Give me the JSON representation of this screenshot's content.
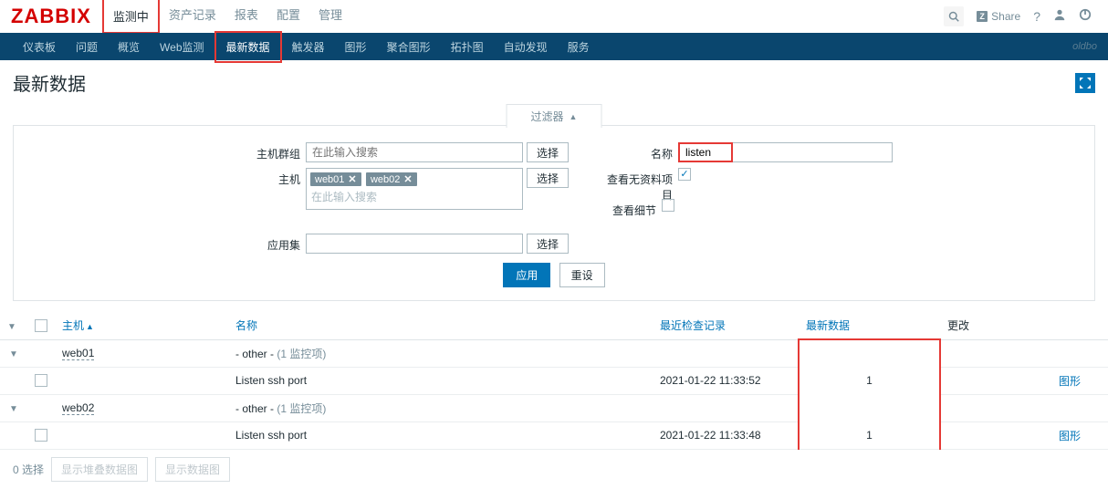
{
  "logo": "ZABBIX",
  "topMenu": [
    "监测中",
    "资产记录",
    "报表",
    "配置",
    "管理"
  ],
  "share": "Share",
  "subMenu": [
    "仪表板",
    "问题",
    "概览",
    "Web监测",
    "最新数据",
    "触发器",
    "图形",
    "聚合图形",
    "拓扑图",
    "自动发现",
    "服务"
  ],
  "subRight": "oldbo",
  "pageTitle": "最新数据",
  "filterTab": "过滤器",
  "filter": {
    "hostGroupLabel": "主机群组",
    "hostGroupPh": "在此输入搜索",
    "hostLabel": "主机",
    "hostPh": "在此输入搜索",
    "hostTags": [
      "web01",
      "web02"
    ],
    "appLabel": "应用集",
    "nameLabel": "名称",
    "nameValue": "listen",
    "noDataLabel": "查看无资料项目",
    "detailLabel": "查看细节",
    "selectBtn": "选择",
    "applyBtn": "应用",
    "resetBtn": "重设"
  },
  "table": {
    "headers": {
      "host": "主机",
      "name": "名称",
      "lastCheck": "最近检查记录",
      "lastData": "最新数据",
      "change": "更改"
    },
    "otherPrefix": "- other -",
    "monCountText": "(1 监控项)",
    "graphText": "图形",
    "rows": [
      {
        "host": "web01",
        "item": "Listen ssh port",
        "time": "2021-01-22 11:33:52",
        "value": "1"
      },
      {
        "host": "web02",
        "item": "Listen ssh port",
        "time": "2021-01-22 11:33:48",
        "value": "1"
      }
    ]
  },
  "footer": {
    "selected": "0 选择",
    "stackBtn": "显示堆叠数据图",
    "graphBtn": "显示数据图"
  }
}
